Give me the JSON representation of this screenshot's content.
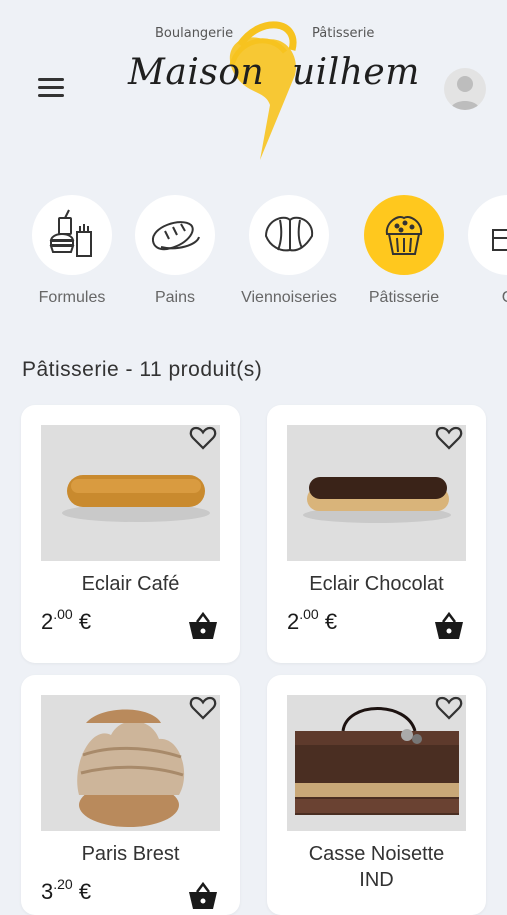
{
  "brand": {
    "left_caption": "Boulangerie",
    "right_caption": "Pâtisserie",
    "word1": "Maison",
    "word2": "uilhem",
    "accent_color": "#f7c31f"
  },
  "categories": [
    {
      "label": "Formules",
      "icon": "burger-fries-drink-icon"
    },
    {
      "label": "Pains",
      "icon": "bread-icon"
    },
    {
      "label": "Viennoiseries",
      "icon": "croissant-icon"
    },
    {
      "label": "Pâtisserie",
      "icon": "muffin-icon",
      "active": true
    },
    {
      "label": "G",
      "icon": "cake-icon"
    }
  ],
  "section_title": "Pâtisserie - 11 produit(s)",
  "products": [
    {
      "name": "Eclair Café",
      "price_int": "2",
      "price_dec": "00",
      "currency": "€"
    },
    {
      "name": "Eclair Chocolat",
      "price_int": "2",
      "price_dec": "00",
      "currency": "€"
    },
    {
      "name": "Paris Brest",
      "price_int": "3",
      "price_dec": "20",
      "currency": "€"
    },
    {
      "name": "Casse Noisette IND",
      "price_int": "",
      "price_dec": "",
      "currency": ""
    }
  ]
}
